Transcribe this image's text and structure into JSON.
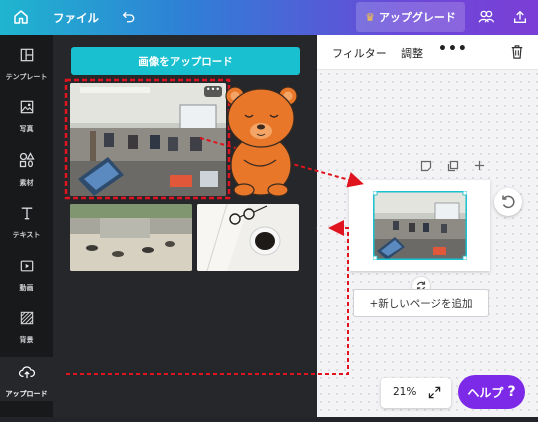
{
  "topbar": {
    "home_icon": "home-icon",
    "file_label": "ファイル",
    "undo_icon": "undo-icon",
    "upgrade_label": "アップグレード",
    "crown_icon": "crown-icon",
    "people_icon": "people-icon",
    "share_icon": "share-icon",
    "gradient_colors": [
      "#1fb5cf",
      "#2f7fd6",
      "#6a48d8",
      "#7b3fd6"
    ]
  },
  "sidebar": {
    "items": [
      {
        "label": "テンプレート",
        "icon": "layout-icon"
      },
      {
        "label": "写真",
        "icon": "photo-icon"
      },
      {
        "label": "素材",
        "icon": "shapes-icon"
      },
      {
        "label": "テキスト",
        "icon": "text-icon"
      },
      {
        "label": "動画",
        "icon": "video-icon"
      },
      {
        "label": "背景",
        "icon": "pattern-icon"
      },
      {
        "label": "アップロード",
        "icon": "cloud-upload-icon",
        "active": true
      }
    ]
  },
  "panel": {
    "upload_button_label": "画像をアップロード",
    "more_label": "•••",
    "collapse_glyph": "‹",
    "accent_color": "#19c0cf"
  },
  "editor": {
    "filter_label": "フィルター",
    "adjust_label": "調整",
    "more_label": "•••",
    "trash_icon": "trash-icon",
    "add_page_label": "+新しいページを追加",
    "zoom_level": "21%",
    "expand_icon": "expand-icon",
    "help_label": "ヘルプ",
    "help_glyph": "?",
    "help_color": "#7d2ae8"
  },
  "annotation": {
    "highlight_color": "#e0141e",
    "mascot_color": "#e8772a"
  }
}
